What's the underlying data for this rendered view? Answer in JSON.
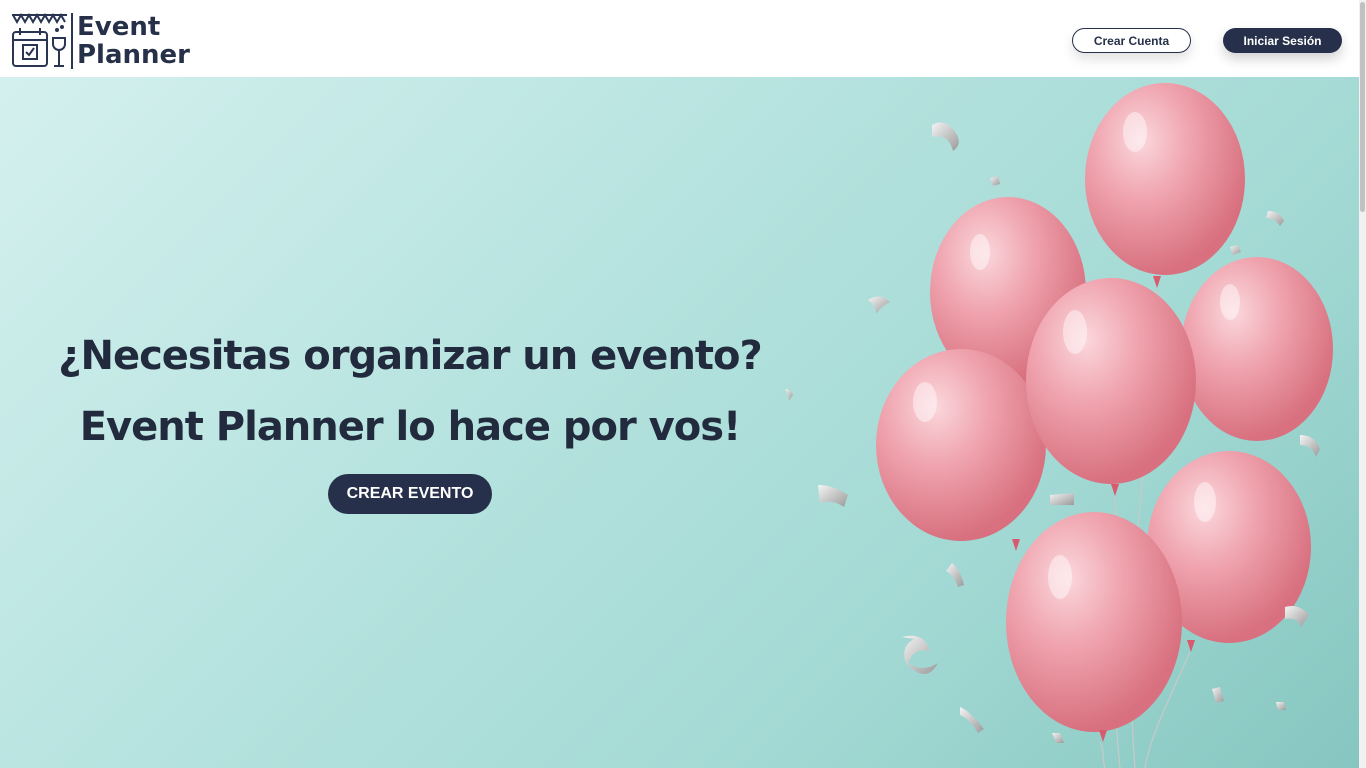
{
  "header": {
    "logo": {
      "line1": "Event",
      "line2": "Planner",
      "icon": "calendar-party-icon"
    },
    "create_account_label": "Crear Cuenta",
    "login_label": "Iniciar Sesión"
  },
  "hero": {
    "headline_line1": "¿Necesitas organizar un evento?",
    "headline_line2": "Event Planner lo hace por vos!",
    "cta_label": "CREAR EVENTO",
    "image": "pink-balloons-with-confetti"
  },
  "colors": {
    "primary_dark": "#27304a",
    "hero_bg": "#b6e3df",
    "balloon_pink": "#ef9fab"
  }
}
